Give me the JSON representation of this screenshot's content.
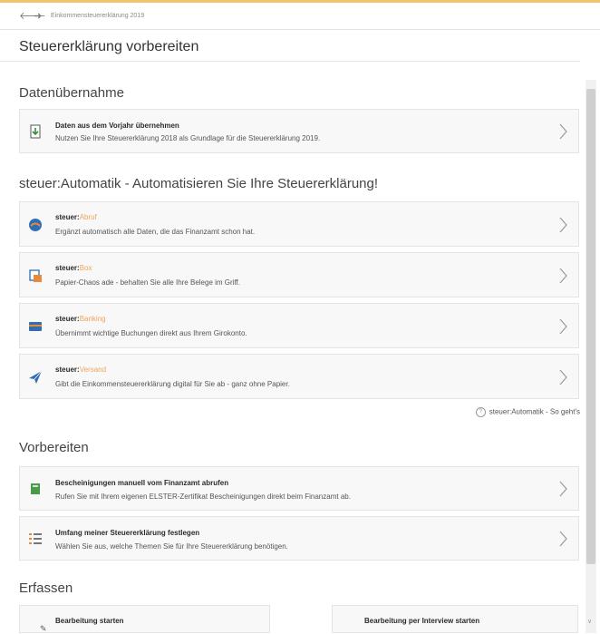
{
  "breadcrumb": "Einkommensteuererklärung 2019",
  "page_title": "Steuererklärung vorbereiten",
  "colors": {
    "accent": "#f2c46b",
    "product_suffix": "#f0a35a",
    "card_bg": "#f8f8f8"
  },
  "sections": {
    "datenuebernahme": {
      "title": "Datenübernahme",
      "items": [
        {
          "title": "Daten aus dem Vorjahr übernehmen",
          "desc": "Nutzen Sie Ihre Steuererklärung 2018 als Grundlage für die Steuererklärung 2019.",
          "icon": "document-import-icon"
        }
      ]
    },
    "automatik": {
      "title": "steuer:Automatik - Automatisieren Sie Ihre Steuererklärung!",
      "items": [
        {
          "prefix": "steuer:",
          "suffix": "Abruf",
          "desc": "Ergänzt automatisch alle Daten, die das Finanzamt schon hat.",
          "icon": "globe-download-icon"
        },
        {
          "prefix": "steuer:",
          "suffix": "Box",
          "desc": "Papier-Chaos ade - behalten Sie alle Ihre Belege im Griff.",
          "icon": "receipt-box-icon"
        },
        {
          "prefix": "steuer:",
          "suffix": "Banking",
          "desc": "Übernimmt wichtige Buchungen direkt aus Ihrem Girokonto.",
          "icon": "bank-card-icon"
        },
        {
          "prefix": "steuer:",
          "suffix": "Versand",
          "desc": "Gibt die Einkommensteuererklärung digital für Sie ab - ganz ohne Papier.",
          "icon": "paper-plane-icon"
        }
      ],
      "help_link": "steuer:Automatik - So geht's"
    },
    "vorbereiten": {
      "title": "Vorbereiten",
      "items": [
        {
          "title": "Bescheinigungen manuell vom Finanzamt abrufen",
          "desc": "Rufen Sie mit Ihrem eigenen ELSTER-Zertifikat Bescheinigungen direkt beim Finanzamt ab.",
          "icon": "certificate-icon"
        },
        {
          "title": "Umfang meiner Steuererklärung festlegen",
          "desc": "Wählen Sie aus, welche Themen Sie für Ihre Steuererklärung benötigen.",
          "icon": "list-icon"
        }
      ]
    },
    "erfassen": {
      "title": "Erfassen",
      "buttons": [
        {
          "label": "Bearbeitung starten"
        },
        {
          "label": "Bearbeitung per Interview starten"
        }
      ]
    }
  }
}
